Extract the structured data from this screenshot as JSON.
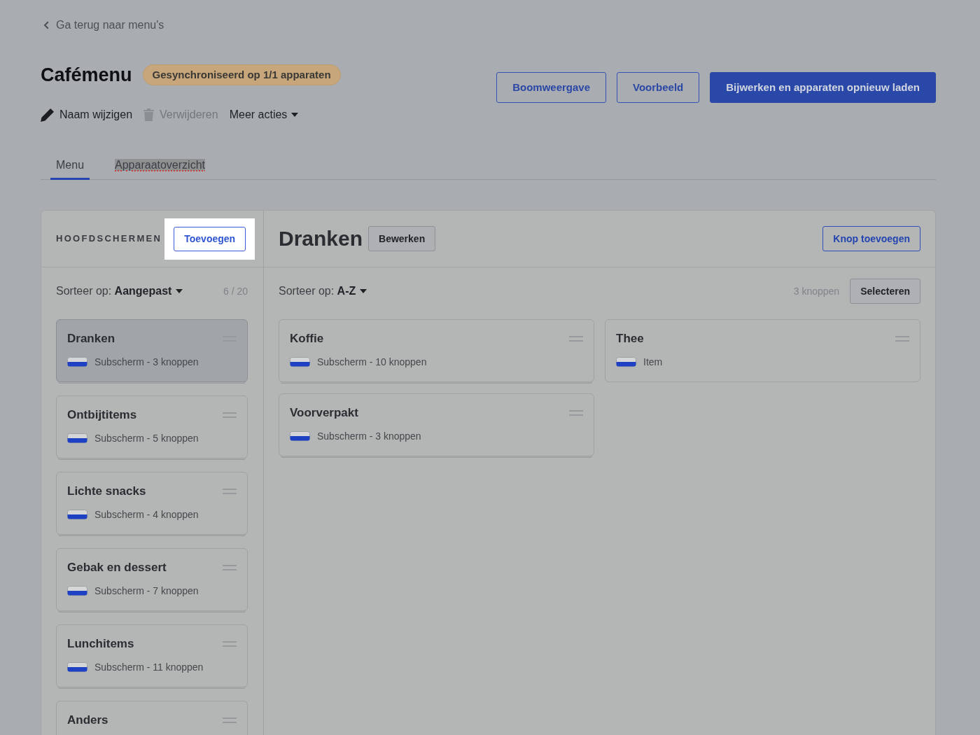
{
  "back_link": {
    "label": "Ga terug naar menu's"
  },
  "header": {
    "title": "Cafémenu",
    "sync_badge": "Gesynchroniseerd op 1/1 apparaten",
    "buttons": [
      {
        "label": "Boomweergave",
        "kind": "outline"
      },
      {
        "label": "Voorbeeld",
        "kind": "outline"
      },
      {
        "label": "Bijwerken en apparaten opnieuw laden",
        "kind": "primary"
      }
    ]
  },
  "actions": [
    {
      "label": "Naam wijzigen",
      "kind": "edit",
      "disabled": false
    },
    {
      "label": "Verwijderen",
      "kind": "delete",
      "disabled": true
    },
    {
      "label": "Meer acties",
      "kind": "dropdown",
      "disabled": false
    }
  ],
  "tabs": [
    {
      "label": "Menu",
      "selected": true,
      "highlighted": false
    },
    {
      "label": "Apparaatoverzicht",
      "selected": false,
      "highlighted": true
    }
  ],
  "sidebar": {
    "heading": "HOOFDSCHERMEN",
    "add_button": {
      "label": "Toevoegen",
      "spotlighted": true
    },
    "sort": "Sorteer op: **Aangepast**",
    "count": "6 / 20",
    "items": [
      {
        "title": "Dranken",
        "subtitle": "Subscherm - 3 knoppen",
        "selected": true
      },
      {
        "title": "Ontbijtitems",
        "subtitle": "Subscherm - 5 knoppen",
        "selected": false
      },
      {
        "title": "Lichte snacks",
        "subtitle": "Subscherm - 4 knoppen",
        "selected": false
      },
      {
        "title": "Gebak en dessert",
        "subtitle": "Subscherm - 7 knoppen",
        "selected": false
      },
      {
        "title": "Lunchitems",
        "subtitle": "Subscherm - 11 knoppen",
        "selected": false
      },
      {
        "title": "Anders",
        "selected": false
      }
    ]
  },
  "content": {
    "title": "Dranken",
    "edit_button": "Bewerken",
    "add_button": "Knop toevoegen",
    "sort": "Sorteer op: **A-Z**",
    "count": "3 knoppen",
    "select_button": "Selecteren",
    "items": [
      {
        "title": "Koffie",
        "subtitle": "Subscherm - 10 knoppen",
        "kind": "subscreen"
      },
      {
        "title": "Thee",
        "subtitle": "Item",
        "kind": "item"
      },
      {
        "title": "Voorverpakt",
        "subtitle": "Subscherm - 3 knoppen",
        "kind": "subscreen"
      }
    ]
  }
}
